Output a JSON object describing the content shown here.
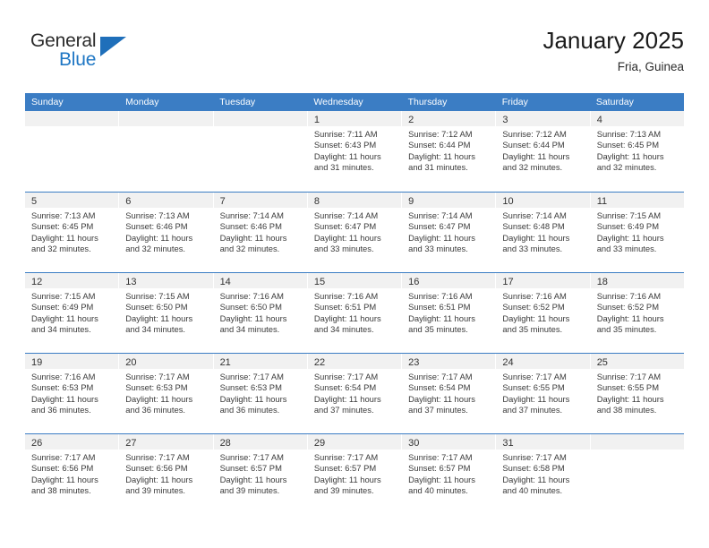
{
  "brand": {
    "name_top": "General",
    "name_bottom": "Blue",
    "accent_color": "#1f77c4",
    "header_color": "#3b7dc4"
  },
  "header": {
    "title": "January 2025",
    "location": "Fria, Guinea"
  },
  "weekdays": [
    "Sunday",
    "Monday",
    "Tuesday",
    "Wednesday",
    "Thursday",
    "Friday",
    "Saturday"
  ],
  "weeks": [
    [
      {
        "empty": true
      },
      {
        "empty": true
      },
      {
        "empty": true
      },
      {
        "day": "1",
        "sunrise": "Sunrise: 7:11 AM",
        "sunset": "Sunset: 6:43 PM",
        "daylight1": "Daylight: 11 hours",
        "daylight2": "and 31 minutes."
      },
      {
        "day": "2",
        "sunrise": "Sunrise: 7:12 AM",
        "sunset": "Sunset: 6:44 PM",
        "daylight1": "Daylight: 11 hours",
        "daylight2": "and 31 minutes."
      },
      {
        "day": "3",
        "sunrise": "Sunrise: 7:12 AM",
        "sunset": "Sunset: 6:44 PM",
        "daylight1": "Daylight: 11 hours",
        "daylight2": "and 32 minutes."
      },
      {
        "day": "4",
        "sunrise": "Sunrise: 7:13 AM",
        "sunset": "Sunset: 6:45 PM",
        "daylight1": "Daylight: 11 hours",
        "daylight2": "and 32 minutes."
      }
    ],
    [
      {
        "day": "5",
        "sunrise": "Sunrise: 7:13 AM",
        "sunset": "Sunset: 6:45 PM",
        "daylight1": "Daylight: 11 hours",
        "daylight2": "and 32 minutes."
      },
      {
        "day": "6",
        "sunrise": "Sunrise: 7:13 AM",
        "sunset": "Sunset: 6:46 PM",
        "daylight1": "Daylight: 11 hours",
        "daylight2": "and 32 minutes."
      },
      {
        "day": "7",
        "sunrise": "Sunrise: 7:14 AM",
        "sunset": "Sunset: 6:46 PM",
        "daylight1": "Daylight: 11 hours",
        "daylight2": "and 32 minutes."
      },
      {
        "day": "8",
        "sunrise": "Sunrise: 7:14 AM",
        "sunset": "Sunset: 6:47 PM",
        "daylight1": "Daylight: 11 hours",
        "daylight2": "and 33 minutes."
      },
      {
        "day": "9",
        "sunrise": "Sunrise: 7:14 AM",
        "sunset": "Sunset: 6:47 PM",
        "daylight1": "Daylight: 11 hours",
        "daylight2": "and 33 minutes."
      },
      {
        "day": "10",
        "sunrise": "Sunrise: 7:14 AM",
        "sunset": "Sunset: 6:48 PM",
        "daylight1": "Daylight: 11 hours",
        "daylight2": "and 33 minutes."
      },
      {
        "day": "11",
        "sunrise": "Sunrise: 7:15 AM",
        "sunset": "Sunset: 6:49 PM",
        "daylight1": "Daylight: 11 hours",
        "daylight2": "and 33 minutes."
      }
    ],
    [
      {
        "day": "12",
        "sunrise": "Sunrise: 7:15 AM",
        "sunset": "Sunset: 6:49 PM",
        "daylight1": "Daylight: 11 hours",
        "daylight2": "and 34 minutes."
      },
      {
        "day": "13",
        "sunrise": "Sunrise: 7:15 AM",
        "sunset": "Sunset: 6:50 PM",
        "daylight1": "Daylight: 11 hours",
        "daylight2": "and 34 minutes."
      },
      {
        "day": "14",
        "sunrise": "Sunrise: 7:16 AM",
        "sunset": "Sunset: 6:50 PM",
        "daylight1": "Daylight: 11 hours",
        "daylight2": "and 34 minutes."
      },
      {
        "day": "15",
        "sunrise": "Sunrise: 7:16 AM",
        "sunset": "Sunset: 6:51 PM",
        "daylight1": "Daylight: 11 hours",
        "daylight2": "and 34 minutes."
      },
      {
        "day": "16",
        "sunrise": "Sunrise: 7:16 AM",
        "sunset": "Sunset: 6:51 PM",
        "daylight1": "Daylight: 11 hours",
        "daylight2": "and 35 minutes."
      },
      {
        "day": "17",
        "sunrise": "Sunrise: 7:16 AM",
        "sunset": "Sunset: 6:52 PM",
        "daylight1": "Daylight: 11 hours",
        "daylight2": "and 35 minutes."
      },
      {
        "day": "18",
        "sunrise": "Sunrise: 7:16 AM",
        "sunset": "Sunset: 6:52 PM",
        "daylight1": "Daylight: 11 hours",
        "daylight2": "and 35 minutes."
      }
    ],
    [
      {
        "day": "19",
        "sunrise": "Sunrise: 7:16 AM",
        "sunset": "Sunset: 6:53 PM",
        "daylight1": "Daylight: 11 hours",
        "daylight2": "and 36 minutes."
      },
      {
        "day": "20",
        "sunrise": "Sunrise: 7:17 AM",
        "sunset": "Sunset: 6:53 PM",
        "daylight1": "Daylight: 11 hours",
        "daylight2": "and 36 minutes."
      },
      {
        "day": "21",
        "sunrise": "Sunrise: 7:17 AM",
        "sunset": "Sunset: 6:53 PM",
        "daylight1": "Daylight: 11 hours",
        "daylight2": "and 36 minutes."
      },
      {
        "day": "22",
        "sunrise": "Sunrise: 7:17 AM",
        "sunset": "Sunset: 6:54 PM",
        "daylight1": "Daylight: 11 hours",
        "daylight2": "and 37 minutes."
      },
      {
        "day": "23",
        "sunrise": "Sunrise: 7:17 AM",
        "sunset": "Sunset: 6:54 PM",
        "daylight1": "Daylight: 11 hours",
        "daylight2": "and 37 minutes."
      },
      {
        "day": "24",
        "sunrise": "Sunrise: 7:17 AM",
        "sunset": "Sunset: 6:55 PM",
        "daylight1": "Daylight: 11 hours",
        "daylight2": "and 37 minutes."
      },
      {
        "day": "25",
        "sunrise": "Sunrise: 7:17 AM",
        "sunset": "Sunset: 6:55 PM",
        "daylight1": "Daylight: 11 hours",
        "daylight2": "and 38 minutes."
      }
    ],
    [
      {
        "day": "26",
        "sunrise": "Sunrise: 7:17 AM",
        "sunset": "Sunset: 6:56 PM",
        "daylight1": "Daylight: 11 hours",
        "daylight2": "and 38 minutes."
      },
      {
        "day": "27",
        "sunrise": "Sunrise: 7:17 AM",
        "sunset": "Sunset: 6:56 PM",
        "daylight1": "Daylight: 11 hours",
        "daylight2": "and 39 minutes."
      },
      {
        "day": "28",
        "sunrise": "Sunrise: 7:17 AM",
        "sunset": "Sunset: 6:57 PM",
        "daylight1": "Daylight: 11 hours",
        "daylight2": "and 39 minutes."
      },
      {
        "day": "29",
        "sunrise": "Sunrise: 7:17 AM",
        "sunset": "Sunset: 6:57 PM",
        "daylight1": "Daylight: 11 hours",
        "daylight2": "and 39 minutes."
      },
      {
        "day": "30",
        "sunrise": "Sunrise: 7:17 AM",
        "sunset": "Sunset: 6:57 PM",
        "daylight1": "Daylight: 11 hours",
        "daylight2": "and 40 minutes."
      },
      {
        "day": "31",
        "sunrise": "Sunrise: 7:17 AM",
        "sunset": "Sunset: 6:58 PM",
        "daylight1": "Daylight: 11 hours",
        "daylight2": "and 40 minutes."
      },
      {
        "empty": true
      }
    ]
  ]
}
